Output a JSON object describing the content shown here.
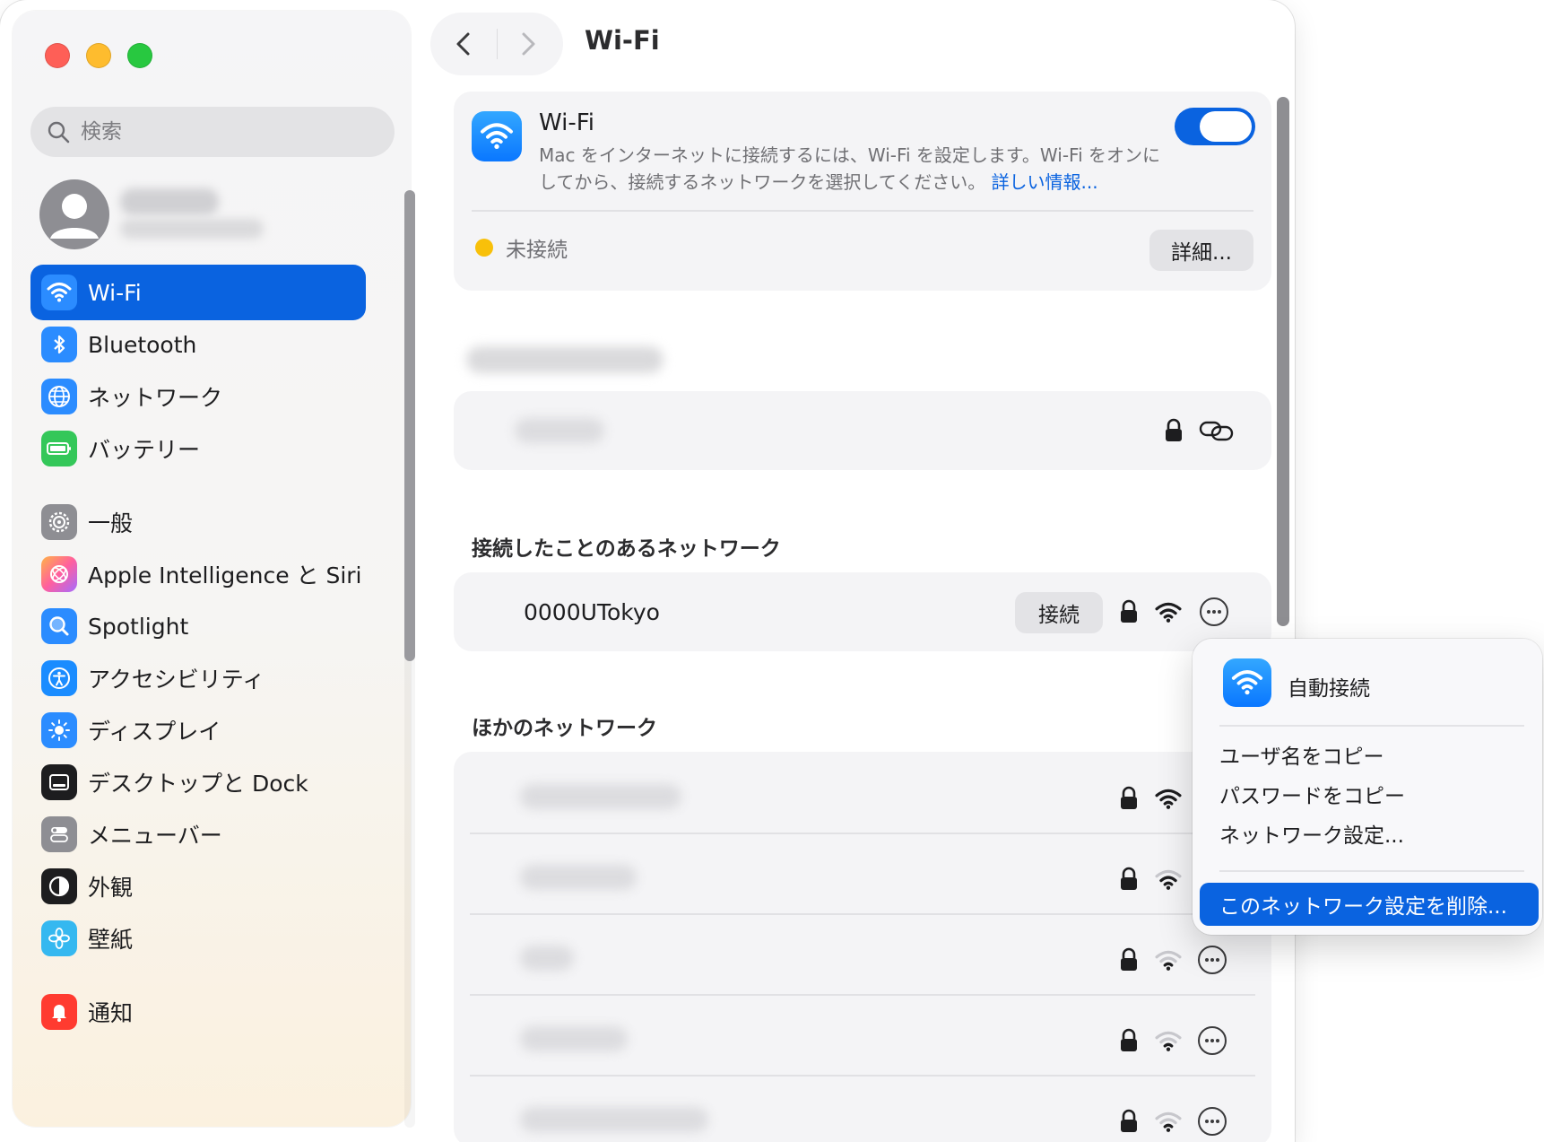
{
  "window": {
    "title": "Wi-Fi"
  },
  "sidebar": {
    "search_placeholder": "検索",
    "items": [
      {
        "label": "Wi-Fi",
        "icon": "wifi-icon",
        "color": "#2b8cff",
        "active": true
      },
      {
        "label": "Bluetooth",
        "icon": "bluetooth-icon",
        "color": "#2b8cff"
      },
      {
        "label": "ネットワーク",
        "icon": "globe-icon",
        "color": "#2b8cff"
      },
      {
        "label": "バッテリー",
        "icon": "battery-icon",
        "color": "#34c759"
      },
      {
        "label": "一般",
        "icon": "gear-icon",
        "color": "#8e8e93"
      },
      {
        "label": "Apple Intelligence と Siri",
        "icon": "siri-icon",
        "color": "#ff6fa5"
      },
      {
        "label": "Spotlight",
        "icon": "magnifier-icon",
        "color": "#2b8cff"
      },
      {
        "label": "アクセシビリティ",
        "icon": "accessibility-icon",
        "color": "#1a8cff"
      },
      {
        "label": "ディスプレイ",
        "icon": "sun-icon",
        "color": "#2b8cff"
      },
      {
        "label": "デスクトップと Dock",
        "icon": "dock-icon",
        "color": "#1d1d1f"
      },
      {
        "label": "メニューバー",
        "icon": "menubar-icon",
        "color": "#8e8e93"
      },
      {
        "label": "外観",
        "icon": "appearance-icon",
        "color": "#1d1d1f"
      },
      {
        "label": "壁紙",
        "icon": "flower-icon",
        "color": "#35b8f0"
      },
      {
        "label": "通知",
        "icon": "bell-icon",
        "color": "#ff3b30"
      }
    ]
  },
  "wifi": {
    "title": "Wi-Fi",
    "description": "Mac をインターネットに接続するには、Wi-Fi を設定します。Wi-Fi をオンにしてから、接続するネットワークを選択してください。",
    "more_info": "詳しい情報...",
    "enabled": true,
    "status": "未接続",
    "status_color": "#f8c00a",
    "details_button": "詳細..."
  },
  "known_networks": {
    "heading": "接続したことのあるネットワーク",
    "items": [
      {
        "name": "0000UTokyo",
        "connect_button": "接続",
        "locked": true
      }
    ]
  },
  "other_networks": {
    "heading": "ほかのネットワーク"
  },
  "context_menu": {
    "auto_join": "自動接続",
    "copy_username": "ユーザ名をコピー",
    "copy_password": "パスワードをコピー",
    "network_settings": "ネットワーク設定...",
    "forget_network": "このネットワーク設定を削除..."
  },
  "colors": {
    "accent": "#0a63e0",
    "traffic_red": "#fe5f57",
    "traffic_yellow": "#febc2e",
    "traffic_green": "#28c840"
  }
}
